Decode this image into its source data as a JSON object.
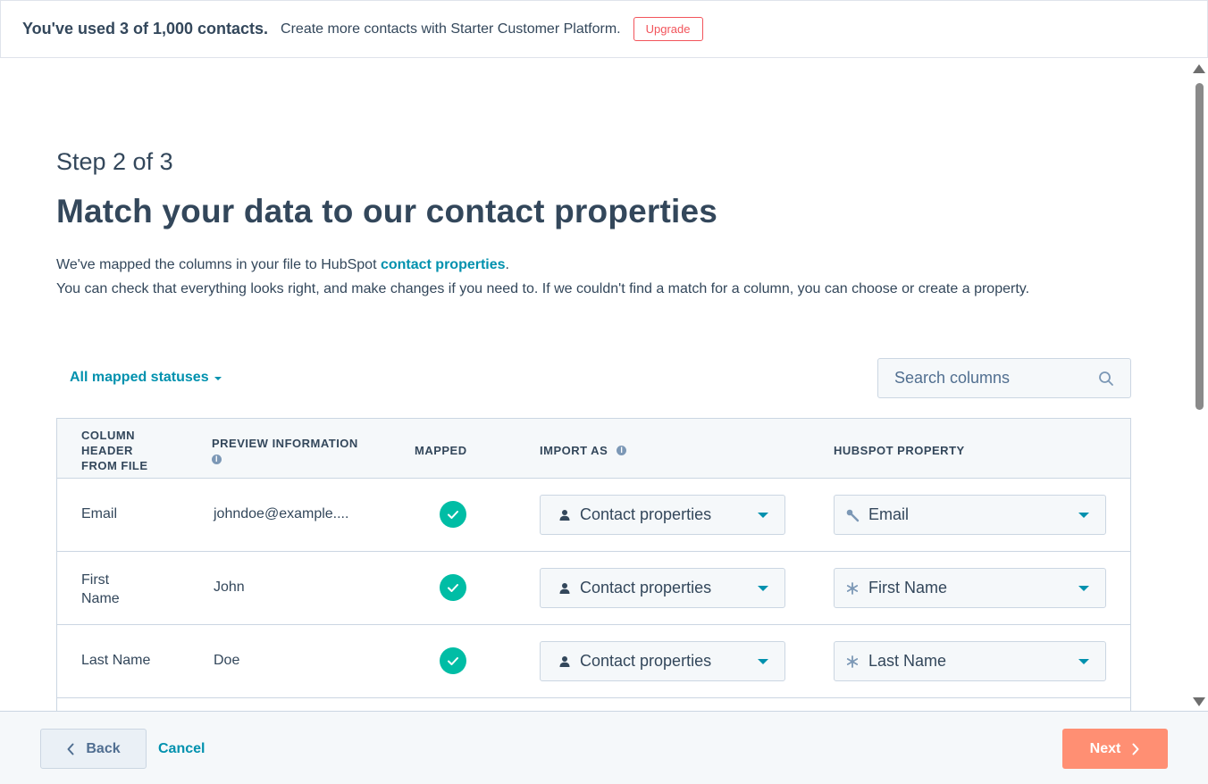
{
  "banner": {
    "usage": "You've used 3 of 1,000 contacts.",
    "message": "Create more contacts with Starter Customer Platform.",
    "upgrade_label": "Upgrade"
  },
  "header": {
    "step": "Step 2 of 3",
    "title": "Match your data to our contact properties",
    "desc_line1_prefix": "We've mapped the columns in your file to HubSpot ",
    "desc_link": "contact properties",
    "desc_line1_suffix": ".",
    "desc_line2": "You can check that everything looks right, and make changes if you need to. If we couldn't find a match for a column, you can choose or create a property."
  },
  "filter": {
    "label": "All mapped statuses"
  },
  "search": {
    "placeholder": "Search columns"
  },
  "table": {
    "headers": {
      "column_header": "COLUMN HEADER FROM FILE",
      "preview": "PREVIEW INFORMATION",
      "mapped": "MAPPED",
      "import_as": "IMPORT AS",
      "hubspot_property": "HUBSPOT PROPERTY"
    },
    "rows": [
      {
        "column": "Email",
        "preview": "johndoe@example....",
        "mapped": true,
        "import_as": "Contact properties",
        "property": "Email",
        "property_icon": "key-icon"
      },
      {
        "column": "First Name",
        "preview": "John",
        "mapped": true,
        "import_as": "Contact properties",
        "property": "First Name",
        "property_icon": "asterisk-icon"
      },
      {
        "column": "Last Name",
        "preview": "Doe",
        "mapped": true,
        "import_as": "Contact properties",
        "property": "Last Name",
        "property_icon": "asterisk-icon"
      }
    ]
  },
  "footer": {
    "back_label": "Back",
    "cancel_label": "Cancel",
    "next_label": "Next"
  },
  "colors": {
    "accent": "#0091ae",
    "primary_text": "#33475b",
    "success": "#00bda5",
    "next_button": "#ff8f73",
    "upgrade_border": "#f2545b"
  }
}
